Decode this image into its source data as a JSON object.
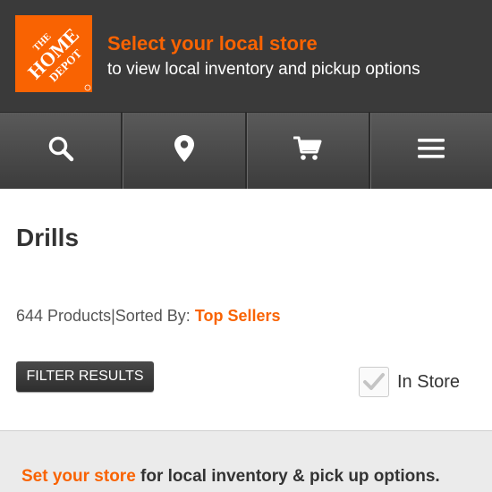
{
  "header": {
    "logo_line1": "THE",
    "logo_line2": "HOME",
    "logo_line3": "DEPOT",
    "store_title": "Select your local store",
    "store_subtitle": "to view local inventory and pickup options"
  },
  "nav": {
    "items": [
      {
        "icon": "search-icon"
      },
      {
        "icon": "location-pin-icon"
      },
      {
        "icon": "cart-icon"
      },
      {
        "icon": "menu-icon"
      }
    ]
  },
  "listing": {
    "title": "Drills",
    "product_count": "644 Products",
    "separator": "|",
    "sorted_by_label": "Sorted By: ",
    "sorted_by_value": "Top Sellers",
    "filter_label": "FILTER RESULTS",
    "in_store_label": "In Store",
    "in_store_checked": true
  },
  "banner": {
    "link_text": "Set your store",
    "rest_text": " for local inventory & pick up options."
  },
  "colors": {
    "brand_orange": "#f96302",
    "header_bg": "#3a3a3a"
  }
}
